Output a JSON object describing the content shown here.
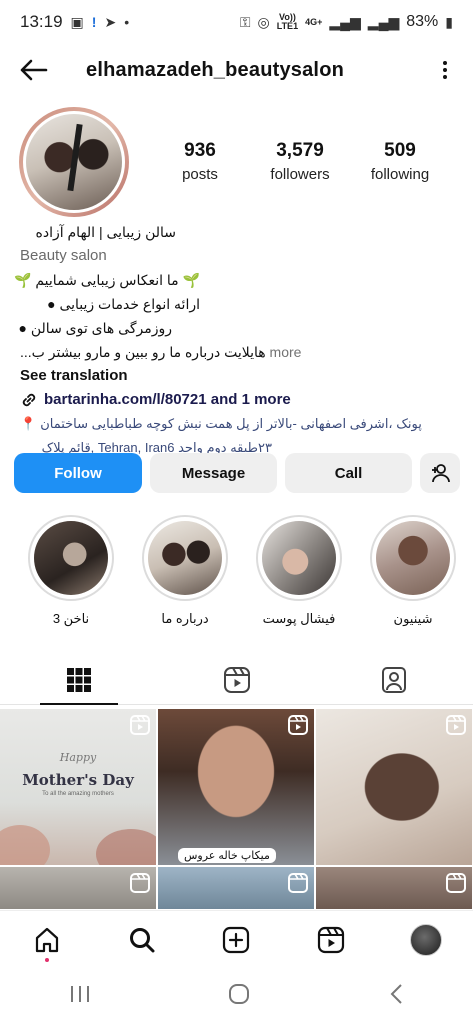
{
  "status_bar": {
    "time": "13:19",
    "network_top": "Vo))",
    "network_bottom": "LTE1",
    "signal_4g": "4G+",
    "battery": "83%"
  },
  "header": {
    "username": "elhamazadeh_beautysalon"
  },
  "stats": [
    {
      "value": "936",
      "label": "posts"
    },
    {
      "value": "3,579",
      "label": "followers"
    },
    {
      "value": "509",
      "label": "following"
    }
  ],
  "bio": {
    "name": "سالن زیبایی | الهام آزاده",
    "category": "Beauty salon",
    "line1": "🌱 ما انعکاس زیبایی شماییم 🌱",
    "line2": "ارائه انواع خدمات زیبایی",
    "line3": "روزمرگی های توی سالن",
    "line4": "هایلایت درباره ما رو ببین و مارو بیشتر ب...",
    "more": "more",
    "see_translation": "See translation",
    "link": "bartarinha.com/l/80721 and 1 more",
    "address1": "پونک ،اشرفی اصفهانی -بالاتر از پل همت نبش کوچه طباطبایی ساختمان",
    "address2": "۲۳طبقه دوم واحد Tehran, Iran6 ,قائم پلاک"
  },
  "actions": {
    "follow": "Follow",
    "message": "Message",
    "call": "Call"
  },
  "highlights": [
    {
      "label": "ناخن 3"
    },
    {
      "label": "درباره ما"
    },
    {
      "label": "فیشال پوست"
    },
    {
      "label": "شینیون"
    }
  ],
  "grid": {
    "post1_happy": "Happy",
    "post1_title": "Mother's Day",
    "post1_sub": "To all the amazing mothers",
    "post2_caption": "میکاپ خاله عروس"
  },
  "colors": {
    "accent": "#1e90f5",
    "button_bg": "#efefef"
  },
  "icons": {
    "back": "arrow-left-icon",
    "more": "more-vertical-icon",
    "add_user": "add-user-icon",
    "grid_tab": "grid-icon",
    "reels_tab": "reels-icon",
    "tagged_tab": "tagged-icon",
    "home": "home-icon",
    "search": "search-icon",
    "create": "create-icon",
    "reels": "reels-icon"
  }
}
